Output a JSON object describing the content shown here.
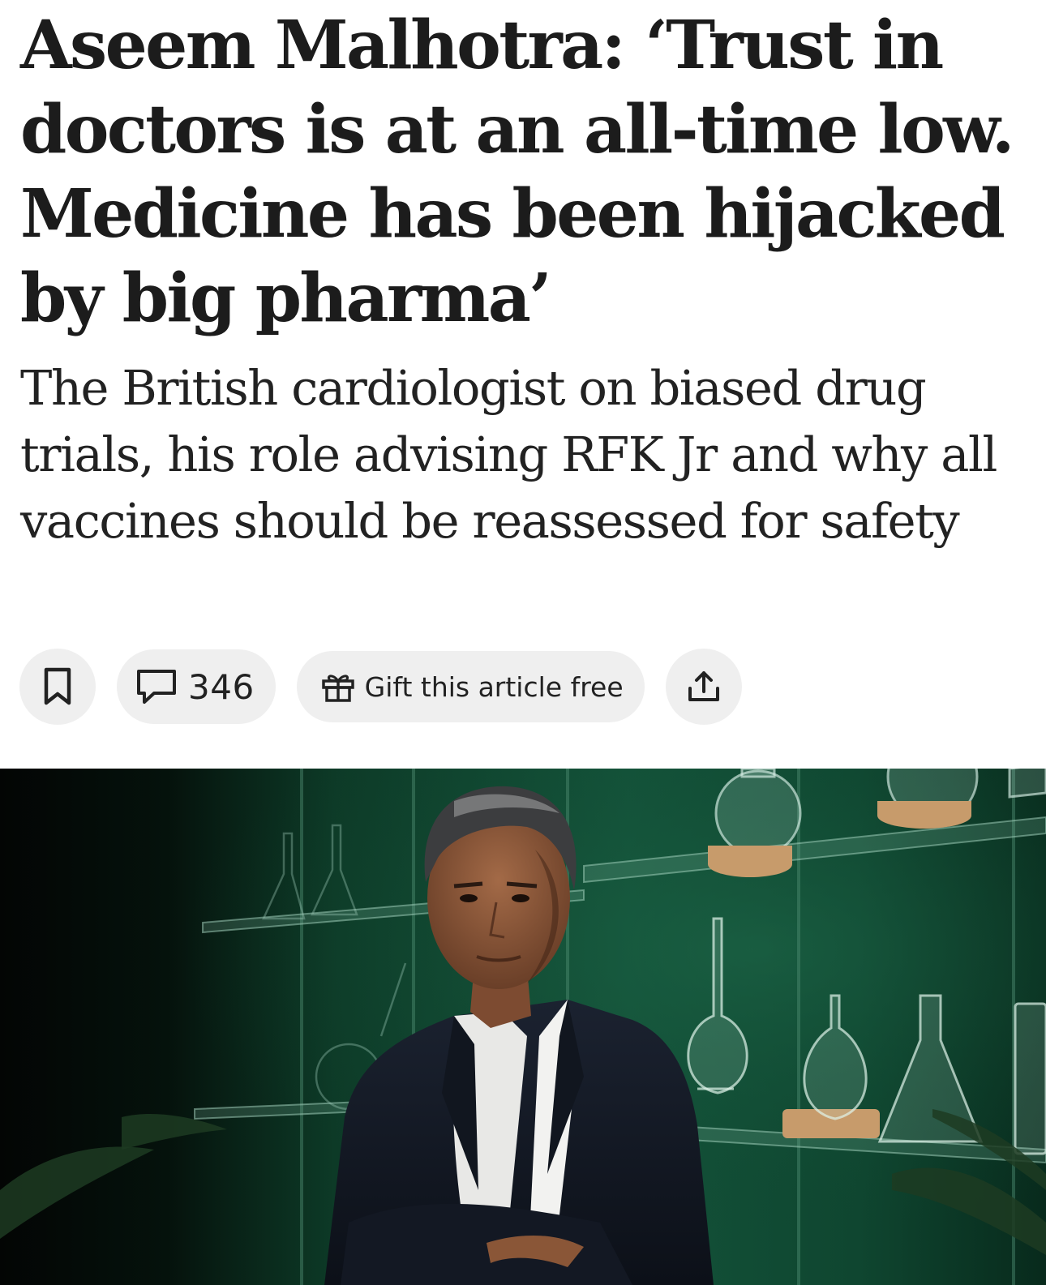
{
  "article": {
    "headline": "Aseem Malhotra: ‘Trust in doctors is at an all-time low. Medicine has been hijacked by big pharma’",
    "standfirst": "The British cardiologist on biased drug trials, his role advising RFK Jr and why all vaccines should be reassessed for safety"
  },
  "toolbar": {
    "bookmark_icon": "bookmark-icon",
    "comment_icon": "speech-bubble-icon",
    "comment_count": "346",
    "gift_icon": "gift-icon",
    "gift_label": "Gift this article free",
    "share_icon": "share-icon"
  },
  "hero_image": {
    "subject": "Portrait photograph: man in dark suit with arms crossed in front of glass laboratory flasks on green shelves"
  },
  "colors": {
    "text": "#1c1c1c",
    "pill_background": "#efefef",
    "hero_green": "#0f4a34"
  }
}
